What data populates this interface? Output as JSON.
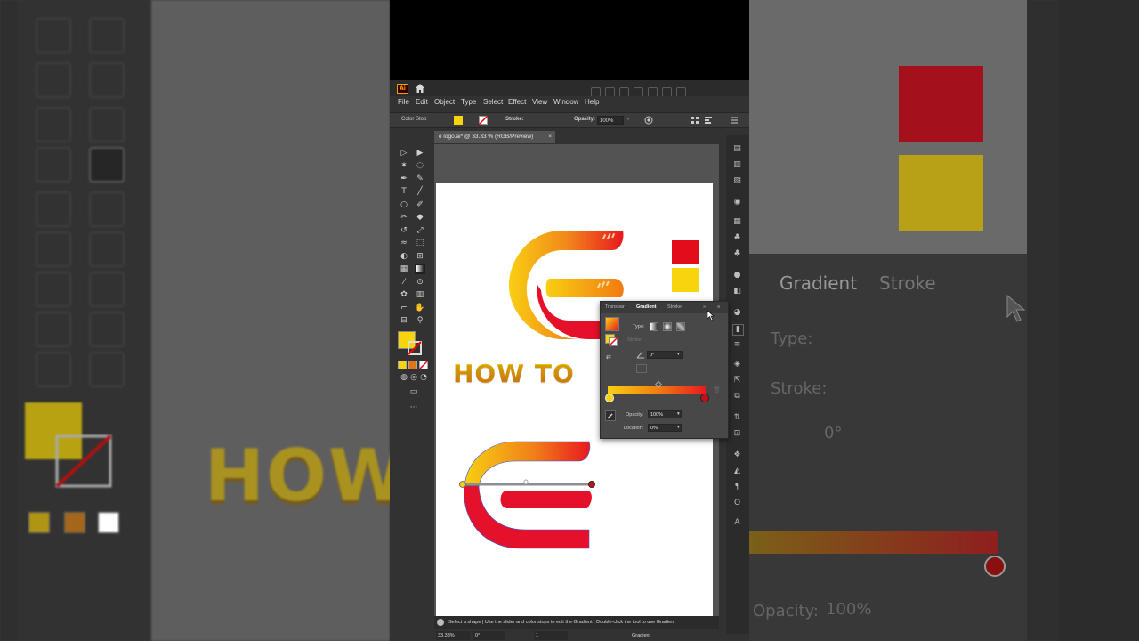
{
  "app": {
    "logo_text": "Ai",
    "document_tab": "e logo.ai* @ 33.33 % (RGB/Preview)",
    "close_glyph": "×"
  },
  "menu": [
    "File",
    "Edit",
    "Object",
    "Type",
    "Select",
    "Effect",
    "View",
    "Window",
    "Help"
  ],
  "control_bar": {
    "mode_label": "Color Stop",
    "stroke_label": "Stroke:",
    "opacity_label": "Opacity:",
    "opacity_value": "100%",
    "arrow": "›"
  },
  "artwork": {
    "headline": "HOW TO",
    "swatch_red": "#e20c1b",
    "swatch_yellow": "#f7d40e"
  },
  "gradient_panel": {
    "tabs": [
      "Transpar",
      "Gradient",
      "Stroke"
    ],
    "type_label": "Type:",
    "stroke_label": "Stroke:",
    "angle_value": "0°",
    "opacity_label": "Opacity:",
    "opacity_value": "100%",
    "location_label": "Location:",
    "location_value": "0%",
    "start_color": "#f8cf12",
    "end_color": "#e8191f"
  },
  "status": {
    "hint": "Select a shape  |  Use the slider and color stops to edit the Gradient  |  Double-click the tool to use Gradien",
    "zoom": "33.33%",
    "rotation": "0°",
    "artboard_num": "1",
    "tool_name": "Gradient"
  },
  "blurred": {
    "headline": "HOW",
    "tabs": [
      "Gradient",
      "Stroke"
    ],
    "type_label": "Type:",
    "stroke_label": "Stroke:",
    "angle_value": "0°",
    "opacity_label": "Opacity:",
    "opacity_value": "100%"
  }
}
